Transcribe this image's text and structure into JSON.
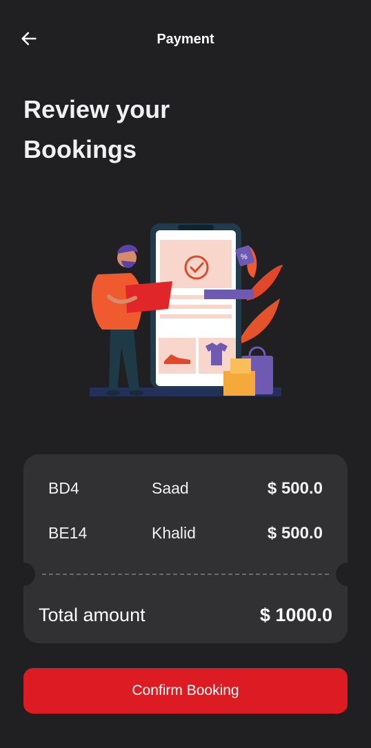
{
  "appbar": {
    "back_icon": "arrow-left-icon",
    "title": "Payment"
  },
  "headline": {
    "line1": "Review your",
    "line2": "Bookings"
  },
  "illustration": {
    "name": "online-shopping-illustration"
  },
  "bookings": {
    "items": [
      {
        "code": "BD4",
        "name": "Saad",
        "amount": "$ 500.0"
      },
      {
        "code": "BE14",
        "name": "Khalid",
        "amount": "$ 500.0"
      }
    ],
    "total_label": "Total amount",
    "total_value": "$ 1000.0"
  },
  "actions": {
    "confirm_label": "Confirm Booking"
  },
  "colors": {
    "background": "#202022",
    "card": "#313134",
    "accent": "#dc1c22"
  }
}
